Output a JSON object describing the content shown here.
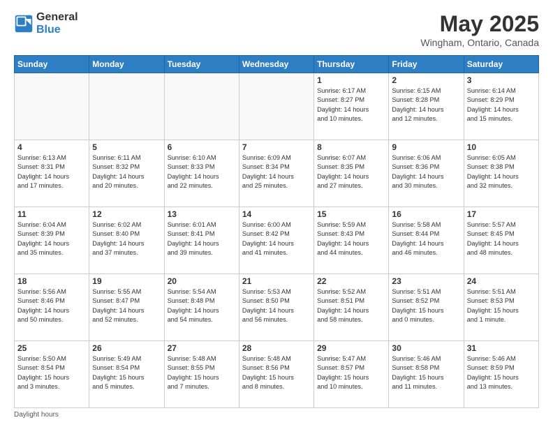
{
  "header": {
    "logo_general": "General",
    "logo_blue": "Blue",
    "month": "May 2025",
    "location": "Wingham, Ontario, Canada"
  },
  "weekdays": [
    "Sunday",
    "Monday",
    "Tuesday",
    "Wednesday",
    "Thursday",
    "Friday",
    "Saturday"
  ],
  "weeks": [
    [
      {
        "day": "",
        "info": ""
      },
      {
        "day": "",
        "info": ""
      },
      {
        "day": "",
        "info": ""
      },
      {
        "day": "",
        "info": ""
      },
      {
        "day": "1",
        "info": "Sunrise: 6:17 AM\nSunset: 8:27 PM\nDaylight: 14 hours\nand 10 minutes."
      },
      {
        "day": "2",
        "info": "Sunrise: 6:15 AM\nSunset: 8:28 PM\nDaylight: 14 hours\nand 12 minutes."
      },
      {
        "day": "3",
        "info": "Sunrise: 6:14 AM\nSunset: 8:29 PM\nDaylight: 14 hours\nand 15 minutes."
      }
    ],
    [
      {
        "day": "4",
        "info": "Sunrise: 6:13 AM\nSunset: 8:31 PM\nDaylight: 14 hours\nand 17 minutes."
      },
      {
        "day": "5",
        "info": "Sunrise: 6:11 AM\nSunset: 8:32 PM\nDaylight: 14 hours\nand 20 minutes."
      },
      {
        "day": "6",
        "info": "Sunrise: 6:10 AM\nSunset: 8:33 PM\nDaylight: 14 hours\nand 22 minutes."
      },
      {
        "day": "7",
        "info": "Sunrise: 6:09 AM\nSunset: 8:34 PM\nDaylight: 14 hours\nand 25 minutes."
      },
      {
        "day": "8",
        "info": "Sunrise: 6:07 AM\nSunset: 8:35 PM\nDaylight: 14 hours\nand 27 minutes."
      },
      {
        "day": "9",
        "info": "Sunrise: 6:06 AM\nSunset: 8:36 PM\nDaylight: 14 hours\nand 30 minutes."
      },
      {
        "day": "10",
        "info": "Sunrise: 6:05 AM\nSunset: 8:38 PM\nDaylight: 14 hours\nand 32 minutes."
      }
    ],
    [
      {
        "day": "11",
        "info": "Sunrise: 6:04 AM\nSunset: 8:39 PM\nDaylight: 14 hours\nand 35 minutes."
      },
      {
        "day": "12",
        "info": "Sunrise: 6:02 AM\nSunset: 8:40 PM\nDaylight: 14 hours\nand 37 minutes."
      },
      {
        "day": "13",
        "info": "Sunrise: 6:01 AM\nSunset: 8:41 PM\nDaylight: 14 hours\nand 39 minutes."
      },
      {
        "day": "14",
        "info": "Sunrise: 6:00 AM\nSunset: 8:42 PM\nDaylight: 14 hours\nand 41 minutes."
      },
      {
        "day": "15",
        "info": "Sunrise: 5:59 AM\nSunset: 8:43 PM\nDaylight: 14 hours\nand 44 minutes."
      },
      {
        "day": "16",
        "info": "Sunrise: 5:58 AM\nSunset: 8:44 PM\nDaylight: 14 hours\nand 46 minutes."
      },
      {
        "day": "17",
        "info": "Sunrise: 5:57 AM\nSunset: 8:45 PM\nDaylight: 14 hours\nand 48 minutes."
      }
    ],
    [
      {
        "day": "18",
        "info": "Sunrise: 5:56 AM\nSunset: 8:46 PM\nDaylight: 14 hours\nand 50 minutes."
      },
      {
        "day": "19",
        "info": "Sunrise: 5:55 AM\nSunset: 8:47 PM\nDaylight: 14 hours\nand 52 minutes."
      },
      {
        "day": "20",
        "info": "Sunrise: 5:54 AM\nSunset: 8:48 PM\nDaylight: 14 hours\nand 54 minutes."
      },
      {
        "day": "21",
        "info": "Sunrise: 5:53 AM\nSunset: 8:50 PM\nDaylight: 14 hours\nand 56 minutes."
      },
      {
        "day": "22",
        "info": "Sunrise: 5:52 AM\nSunset: 8:51 PM\nDaylight: 14 hours\nand 58 minutes."
      },
      {
        "day": "23",
        "info": "Sunrise: 5:51 AM\nSunset: 8:52 PM\nDaylight: 15 hours\nand 0 minutes."
      },
      {
        "day": "24",
        "info": "Sunrise: 5:51 AM\nSunset: 8:53 PM\nDaylight: 15 hours\nand 1 minute."
      }
    ],
    [
      {
        "day": "25",
        "info": "Sunrise: 5:50 AM\nSunset: 8:54 PM\nDaylight: 15 hours\nand 3 minutes."
      },
      {
        "day": "26",
        "info": "Sunrise: 5:49 AM\nSunset: 8:54 PM\nDaylight: 15 hours\nand 5 minutes."
      },
      {
        "day": "27",
        "info": "Sunrise: 5:48 AM\nSunset: 8:55 PM\nDaylight: 15 hours\nand 7 minutes."
      },
      {
        "day": "28",
        "info": "Sunrise: 5:48 AM\nSunset: 8:56 PM\nDaylight: 15 hours\nand 8 minutes."
      },
      {
        "day": "29",
        "info": "Sunrise: 5:47 AM\nSunset: 8:57 PM\nDaylight: 15 hours\nand 10 minutes."
      },
      {
        "day": "30",
        "info": "Sunrise: 5:46 AM\nSunset: 8:58 PM\nDaylight: 15 hours\nand 11 minutes."
      },
      {
        "day": "31",
        "info": "Sunrise: 5:46 AM\nSunset: 8:59 PM\nDaylight: 15 hours\nand 13 minutes."
      }
    ]
  ],
  "footer": "Daylight hours"
}
